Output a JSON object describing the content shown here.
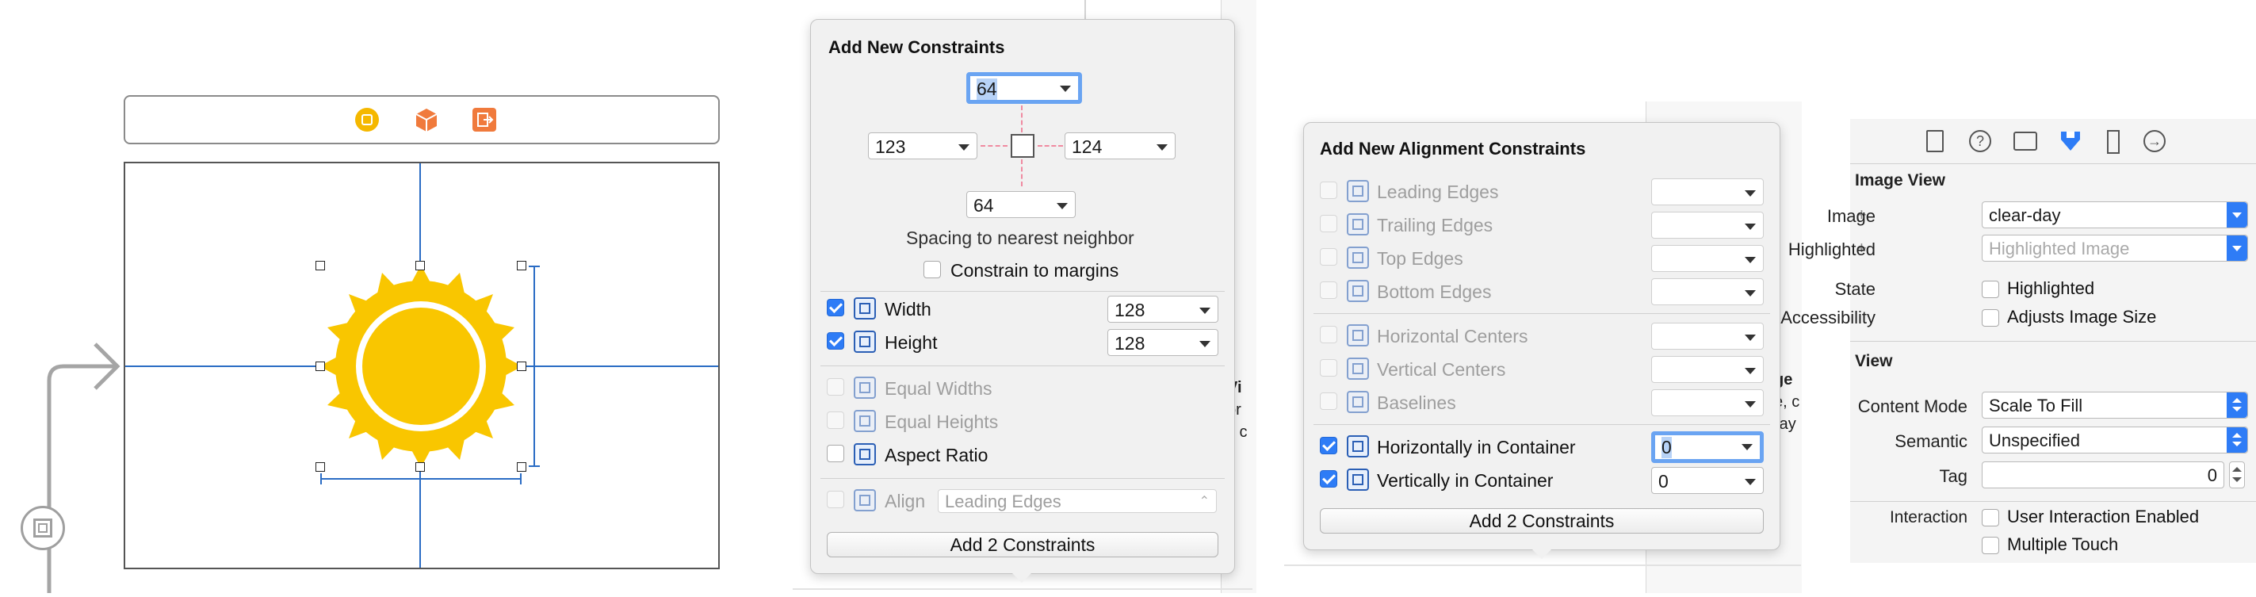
{
  "canvas": {
    "scene_dock": {
      "icons": [
        "view-controller-icon",
        "first-responder-icon",
        "exit-icon"
      ]
    }
  },
  "constraints_popover": {
    "title": "Add New Constraints",
    "top_value": "64",
    "left_value": "123",
    "right_value": "124",
    "bottom_value": "64",
    "spacing_label": "Spacing to nearest neighbor",
    "constrain_margins_label": "Constrain to margins",
    "width_label": "Width",
    "width_value": "128",
    "height_label": "Height",
    "height_value": "128",
    "equal_widths_label": "Equal Widths",
    "equal_heights_label": "Equal Heights",
    "aspect_ratio_label": "Aspect Ratio",
    "align_label": "Align",
    "align_value": "Leading Edges",
    "add_button": "Add 2 Constraints"
  },
  "alignment_popover": {
    "title": "Add New Alignment Constraints",
    "rows": [
      {
        "label": "Leading Edges",
        "checked": false,
        "enabled": false,
        "value": ""
      },
      {
        "label": "Trailing Edges",
        "checked": false,
        "enabled": false,
        "value": ""
      },
      {
        "label": "Top Edges",
        "checked": false,
        "enabled": false,
        "value": ""
      },
      {
        "label": "Bottom Edges",
        "checked": false,
        "enabled": false,
        "value": ""
      },
      {
        "label": "Horizontal Centers",
        "checked": false,
        "enabled": false,
        "value": ""
      },
      {
        "label": "Vertical Centers",
        "checked": false,
        "enabled": false,
        "value": ""
      },
      {
        "label": "Baselines",
        "checked": false,
        "enabled": false,
        "value": ""
      },
      {
        "label": "Horizontally in Container",
        "checked": true,
        "enabled": true,
        "value": "0"
      },
      {
        "label": "Vertically in Container",
        "checked": true,
        "enabled": true,
        "value": "0"
      }
    ],
    "add_button": "Add 2 Constraints"
  },
  "background_fragments": {
    "frag1_lines": [
      "Vi",
      "or",
      "y c"
    ],
    "frag2_lines": [
      "ge",
      "e, c",
      "ray"
    ]
  },
  "inspector": {
    "section_image_view": "Image View",
    "image_label": "Image",
    "image_value": "clear-day",
    "highlighted_label": "Highlighted",
    "highlighted_placeholder": "Highlighted Image",
    "state_label": "State",
    "state_checkbox_label": "Highlighted",
    "accessibility_label": "Accessibility",
    "accessibility_checkbox_label": "Adjusts Image Size",
    "section_view": "View",
    "content_mode_label": "Content Mode",
    "content_mode_value": "Scale To Fill",
    "semantic_label": "Semantic",
    "semantic_value": "Unspecified",
    "tag_label": "Tag",
    "tag_value": "0",
    "interaction_label": "Interaction",
    "user_interaction_label": "User Interaction Enabled",
    "multiple_touch_label": "Multiple Touch"
  },
  "colors": {
    "accent": "#2e7cf6",
    "sun": "#f9c600",
    "constraint_line": "#2a6cc4",
    "dock_yellow": "#f5b800",
    "dock_orange": "#f07a3c"
  }
}
